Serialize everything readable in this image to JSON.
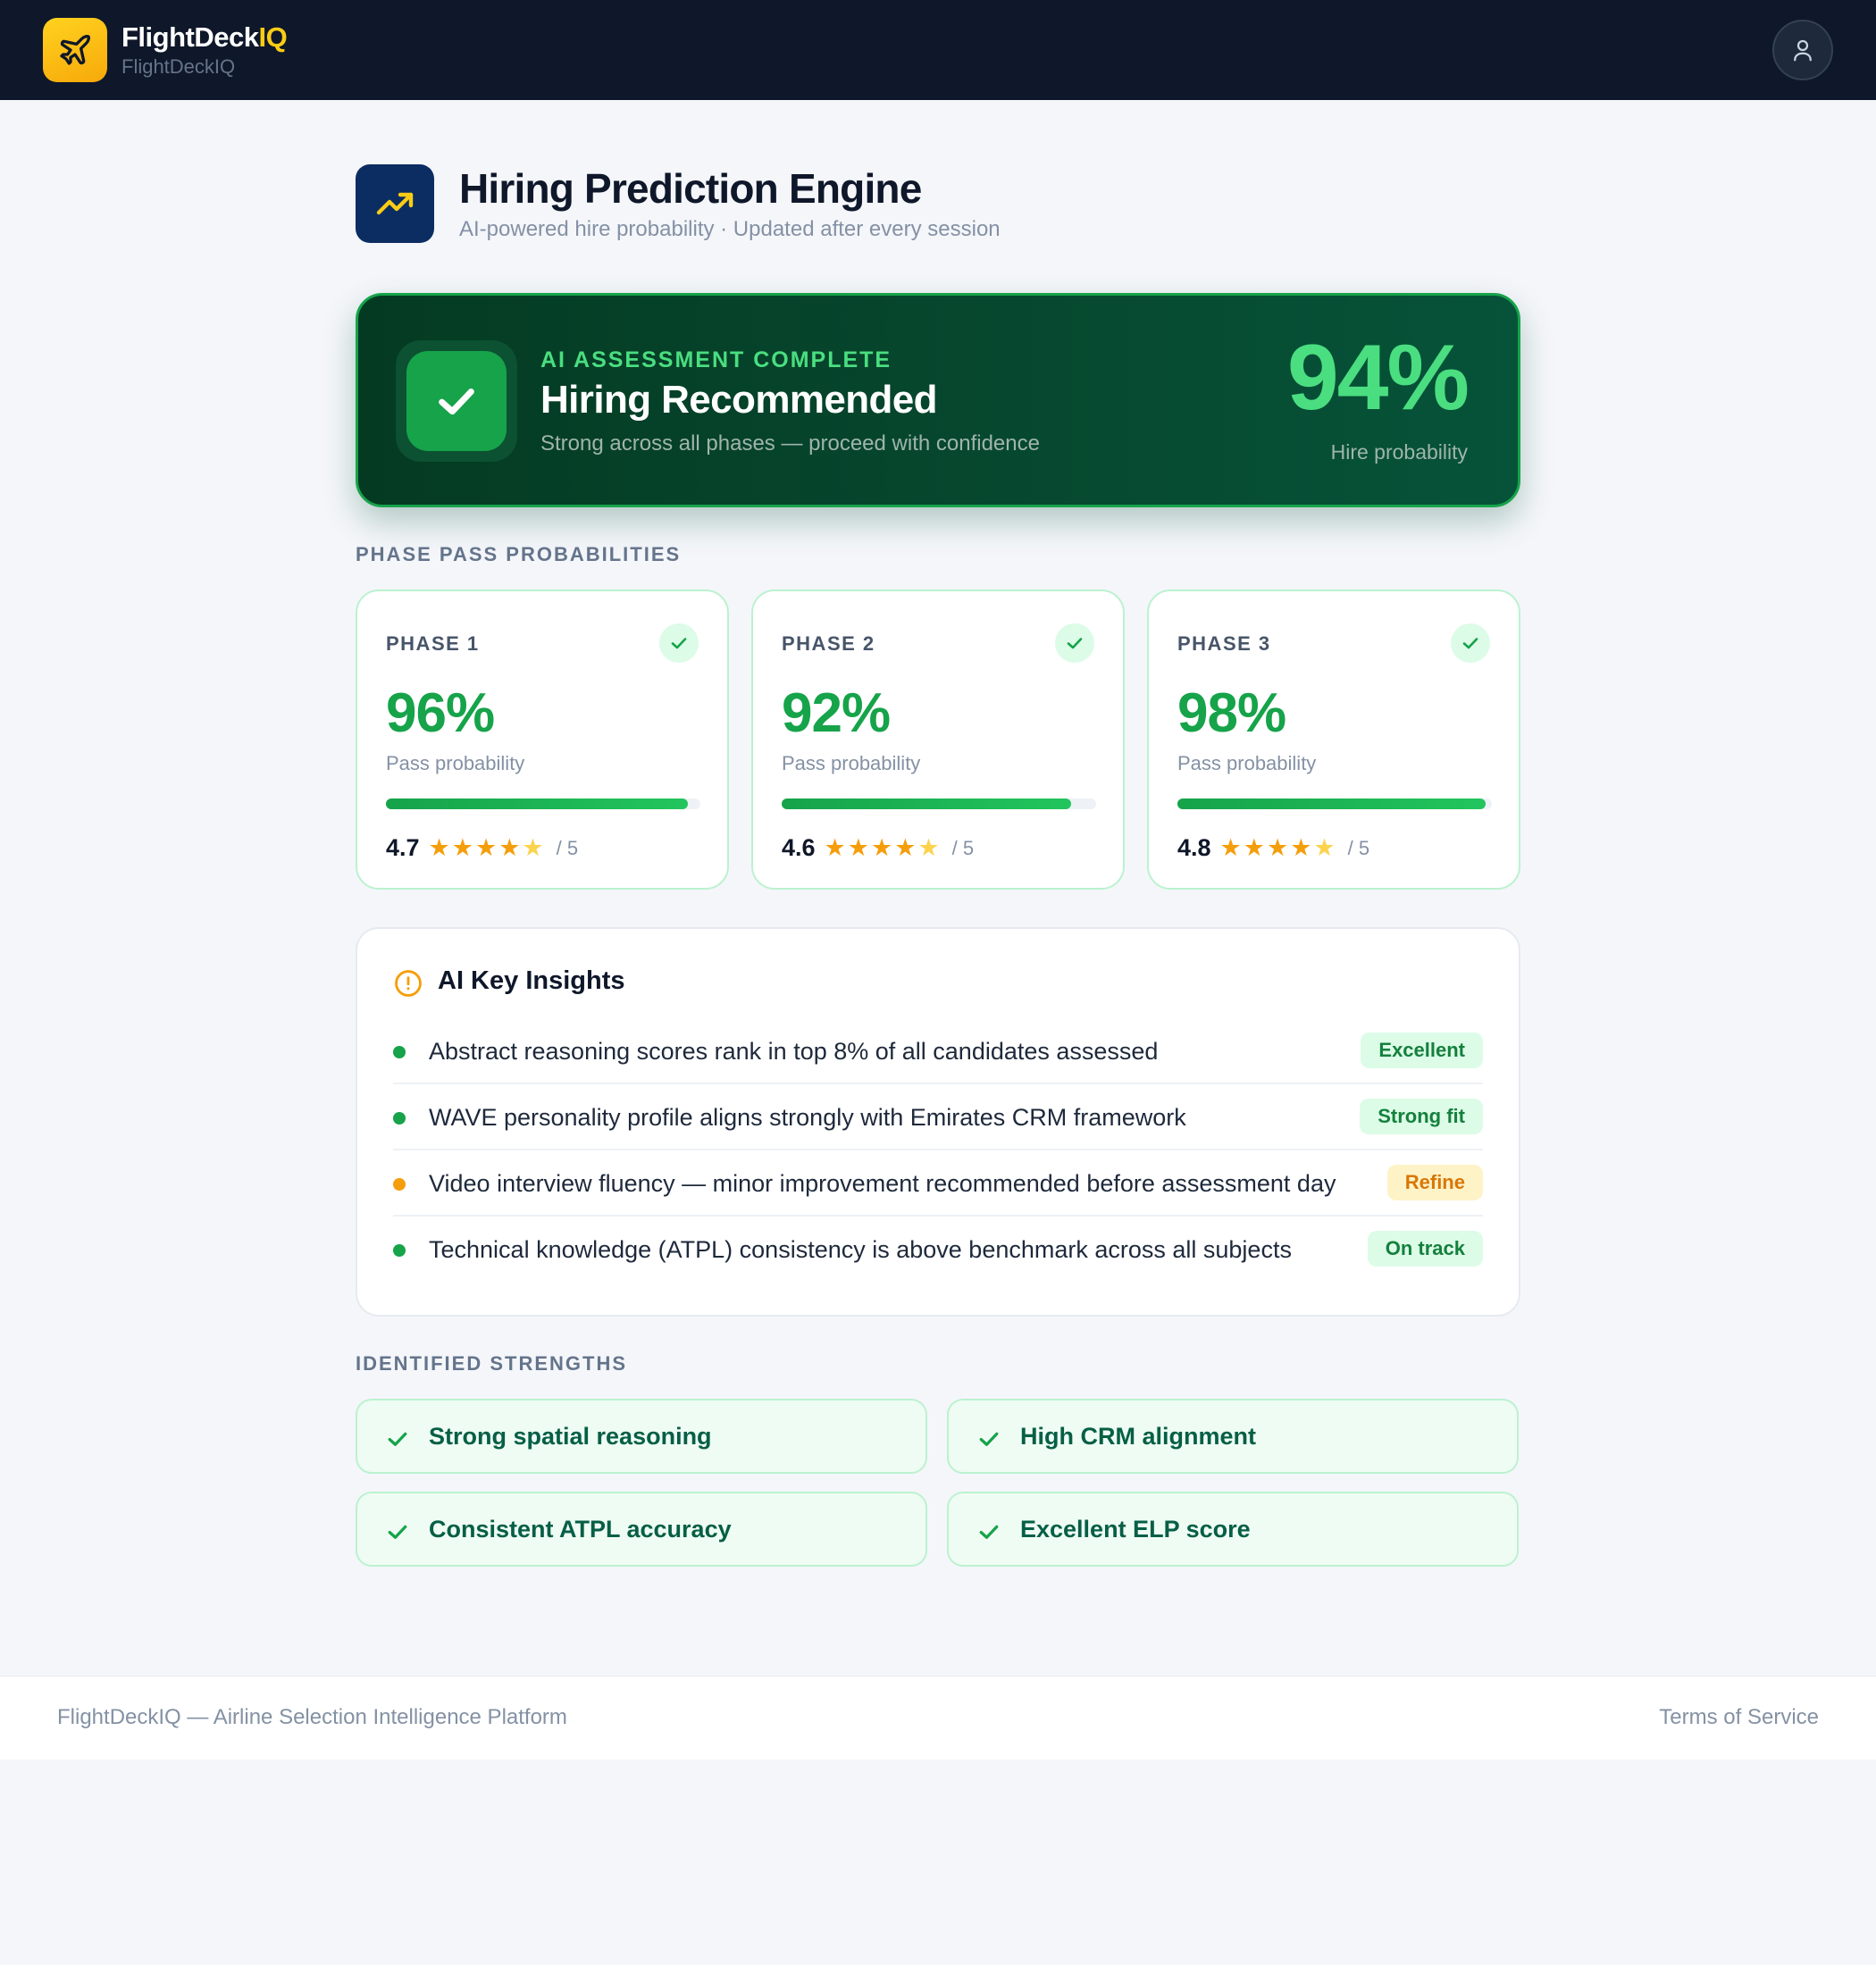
{
  "header": {
    "brand_name_main": "FlightDeck",
    "brand_name_accent": "IQ",
    "brand_subtitle": "FlightDeckIQ",
    "logo_icon": "plane-icon",
    "avatar_icon": "user-icon"
  },
  "page": {
    "title": "Hiring Prediction Engine",
    "subtitle": "AI-powered hire probability · Updated after every session",
    "icon": "trending-up-icon"
  },
  "hero": {
    "eyebrow": "AI ASSESSMENT COMPLETE",
    "title": "Hiring Recommended",
    "description": "Strong across all phases — proceed with confidence",
    "value": "94%",
    "value_label": "Hire probability",
    "icon": "check-icon"
  },
  "phases_section": {
    "label": "PHASE PASS PROBABILITIES",
    "phases": [
      {
        "label": "PHASE 1",
        "value": "96%",
        "value_label": "Pass probability",
        "progress": 0.96,
        "rating": "4.7",
        "rating_value": 4.7,
        "rating_max": "/ 5"
      },
      {
        "label": "PHASE 2",
        "value": "92%",
        "value_label": "Pass probability",
        "progress": 0.92,
        "rating": "4.6",
        "rating_value": 4.6,
        "rating_max": "/ 5"
      },
      {
        "label": "PHASE 3",
        "value": "98%",
        "value_label": "Pass probability",
        "progress": 0.98,
        "rating": "4.8",
        "rating_value": 4.8,
        "rating_max": "/ 5"
      }
    ]
  },
  "insights": {
    "title": "AI Key Insights",
    "icon": "alert-circle-icon",
    "items": [
      {
        "text": "Abstract reasoning scores rank in top 8% of all candidates assessed",
        "badge": "Excellent",
        "tone": "green"
      },
      {
        "text": "WAVE personality profile aligns strongly with Emirates CRM framework",
        "badge": "Strong fit",
        "tone": "green"
      },
      {
        "text": "Video interview fluency — minor improvement recommended before assessment day",
        "badge": "Refine",
        "tone": "amber"
      },
      {
        "text": "Technical knowledge (ATPL) consistency is above benchmark across all subjects",
        "badge": "On track",
        "tone": "green"
      }
    ]
  },
  "strengths": {
    "label": "IDENTIFIED STRENGTHS",
    "items": [
      "Strong spatial reasoning",
      "High CRM alignment",
      "Consistent ATPL accuracy",
      "Excellent ELP score"
    ]
  },
  "footer": {
    "left": "FlightDeckIQ — Airline Selection Intelligence Platform",
    "right": "Terms of Service"
  },
  "colors": {
    "green": "#16a34a",
    "amber": "#f59e0b",
    "navy": "#0f172a",
    "star": "#f59e0b",
    "star_partial": "#fcd34d"
  }
}
